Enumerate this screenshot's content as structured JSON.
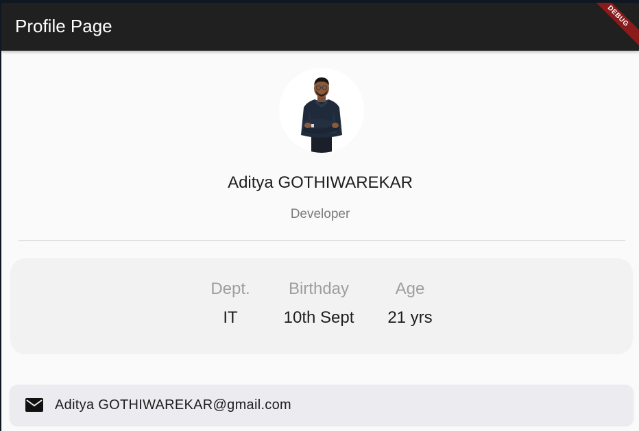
{
  "app_bar": {
    "title": "Profile Page",
    "background": "#202020"
  },
  "debug_banner": {
    "label": "DEBUG",
    "color": "#8b1a1a"
  },
  "profile": {
    "avatar_icon": "person-photo-icon",
    "name": "Aditya GOTHIWAREKAR",
    "role": "Developer"
  },
  "stats": [
    {
      "label": "Dept.",
      "value": "IT"
    },
    {
      "label": "Birthday",
      "value": "10th Sept"
    },
    {
      "label": "Age",
      "value": "21 yrs"
    }
  ],
  "contact": {
    "icon": "mail-icon",
    "email": "Aditya GOTHIWAREKAR@gmail.com"
  }
}
